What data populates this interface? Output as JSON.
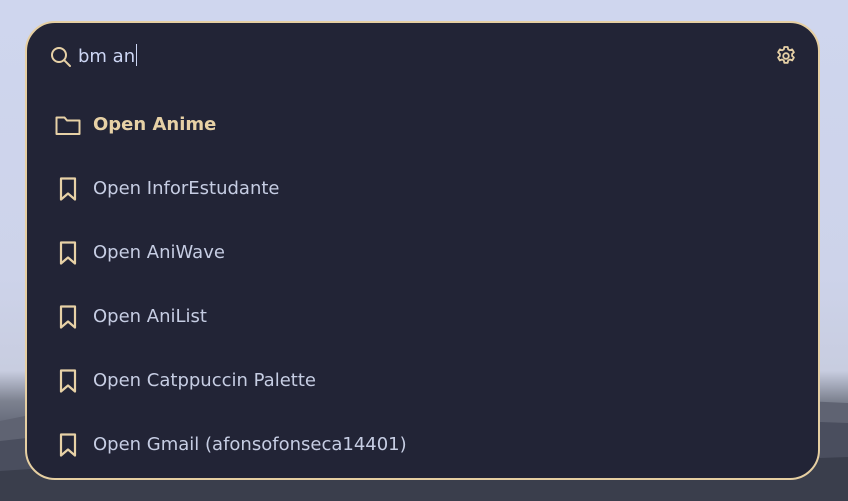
{
  "colors": {
    "panel_background": "#222436",
    "panel_border": "#e6cfa2",
    "accent": "#e7d1a6",
    "text": "#c6cde3"
  },
  "search": {
    "query": "bm an",
    "icon": "search-icon"
  },
  "settings": {
    "icon": "gear-icon"
  },
  "results": [
    {
      "label": "Open Anime",
      "icon": "folder-icon",
      "selected": true
    },
    {
      "label": "Open InforEstudante",
      "icon": "bookmark-icon",
      "selected": false
    },
    {
      "label": "Open AniWave",
      "icon": "bookmark-icon",
      "selected": false
    },
    {
      "label": "Open AniList",
      "icon": "bookmark-icon",
      "selected": false
    },
    {
      "label": "Open Catppuccin Palette",
      "icon": "bookmark-icon",
      "selected": false
    },
    {
      "label": "Open Gmail (afonsofonseca14401)",
      "icon": "bookmark-icon",
      "selected": false
    }
  ]
}
